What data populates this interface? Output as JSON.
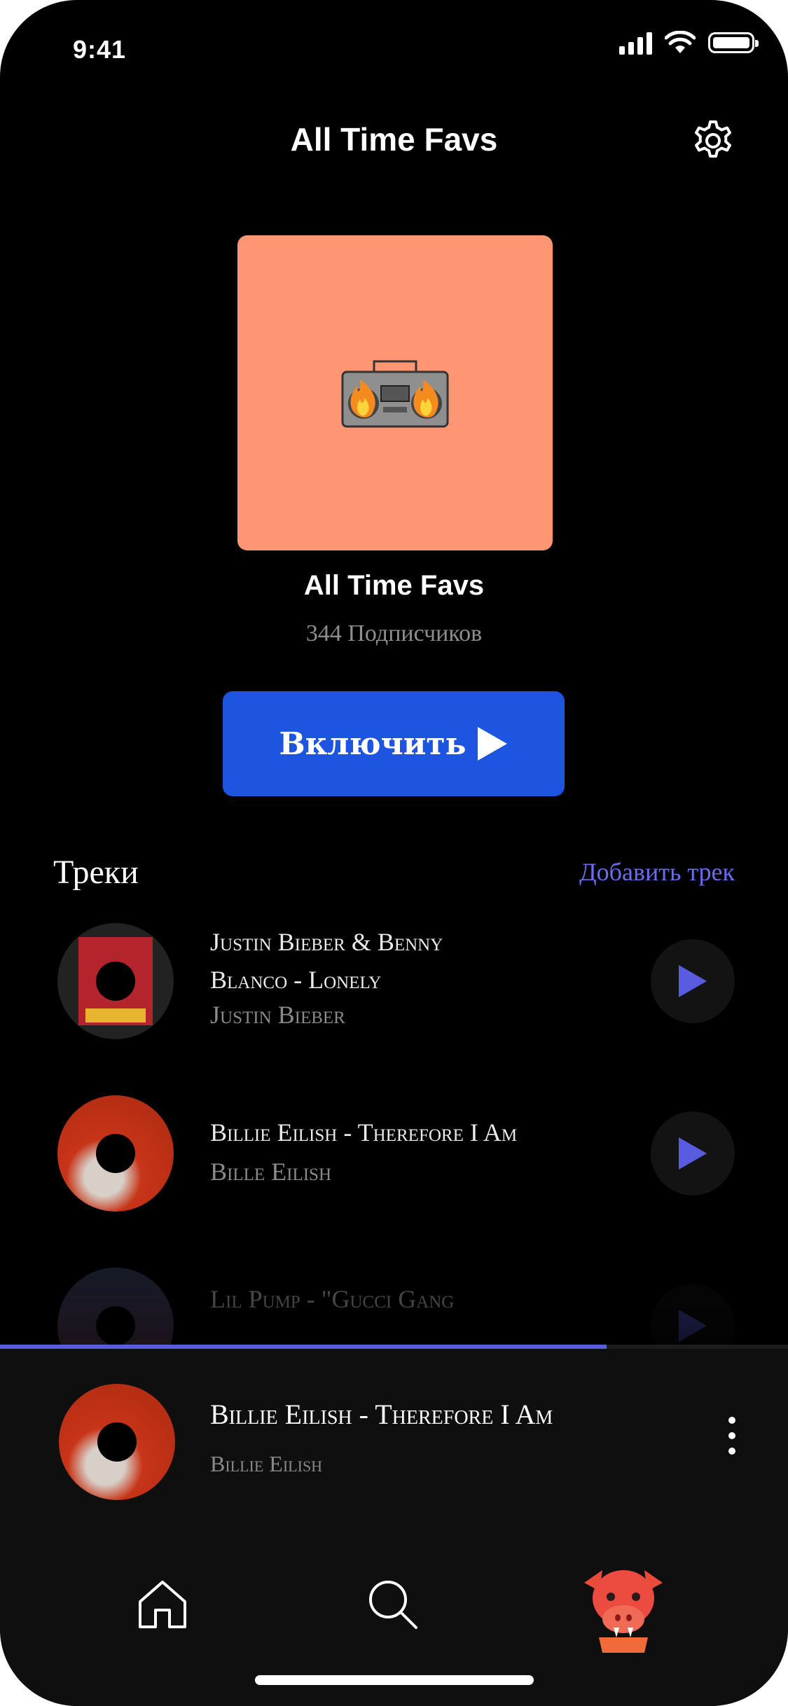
{
  "status_bar": {
    "time": "9:41"
  },
  "header": {
    "title": "All Time Favs"
  },
  "playlist": {
    "name": "All Time Favs",
    "followers": "344 Подписчиков",
    "cover_color": "#FF9673",
    "play_label": "Включить"
  },
  "tracks_section": {
    "title": "Треки",
    "add_label": "Добавить трек"
  },
  "tracks": [
    {
      "title": "Justin Bieber & Benny Blanco - Lonely",
      "artist": "Justin Bieber"
    },
    {
      "title": "Billie Eilish - Therefore I Am",
      "artist": "Bille Eilish"
    },
    {
      "title": "Lil Pump - \"Gucci Gang"
    }
  ],
  "now_playing": {
    "title": "Billie Eilish - Therefore I Am",
    "artist": "Billie Eilish",
    "progress": 0.77
  },
  "colors": {
    "accent": "#1D54E0",
    "link": "#6A6DF0",
    "play_icon": "#5A5CE0"
  },
  "tabbar": {
    "items": [
      "home-icon",
      "search-icon",
      "profile-avatar"
    ]
  }
}
